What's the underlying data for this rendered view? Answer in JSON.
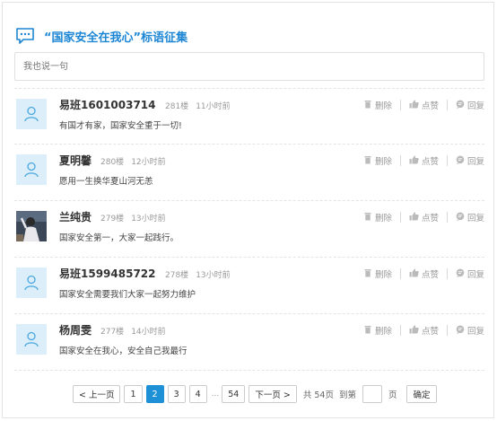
{
  "header": {
    "title": "“国家安全在我心”标语征集",
    "icon": "comment-icon",
    "accent": "#1d86d4"
  },
  "input": {
    "placeholder": "我也说一句"
  },
  "actions": {
    "delete": "删除",
    "like": "点赞",
    "reply": "回复"
  },
  "comments": [
    {
      "name": "易班1601003714",
      "floor": "281楼",
      "time": "11小时前",
      "content": "有国才有家，国家安全重于一切!",
      "avatar": "default-avatar"
    },
    {
      "name": "夏明馨",
      "floor": "280楼",
      "time": "12小时前",
      "content": "愿用一生换华夏山河无恙",
      "avatar": "default-avatar"
    },
    {
      "name": "兰纯贵",
      "floor": "279楼",
      "time": "13小时前",
      "content": "国家安全第一，大家一起践行。",
      "avatar": "photo-avatar"
    },
    {
      "name": "易班1599485722",
      "floor": "278楼",
      "time": "13小时前",
      "content": "国家安全需要我们大家一起努力维护",
      "avatar": "default-avatar"
    },
    {
      "name": "杨周雯",
      "floor": "277楼",
      "time": "14小时前",
      "content": "国家安全在我心，安全自己我最行",
      "avatar": "default-avatar"
    }
  ],
  "pagination": {
    "prev": "< 上一页",
    "pages": [
      "1",
      "2",
      "3",
      "4"
    ],
    "current": "2",
    "ellipsis": "...",
    "last": "54",
    "next": "下一页 >",
    "total": "共 54页",
    "goto_prefix": "到第",
    "goto_suffix": "页",
    "confirm": "确定"
  }
}
